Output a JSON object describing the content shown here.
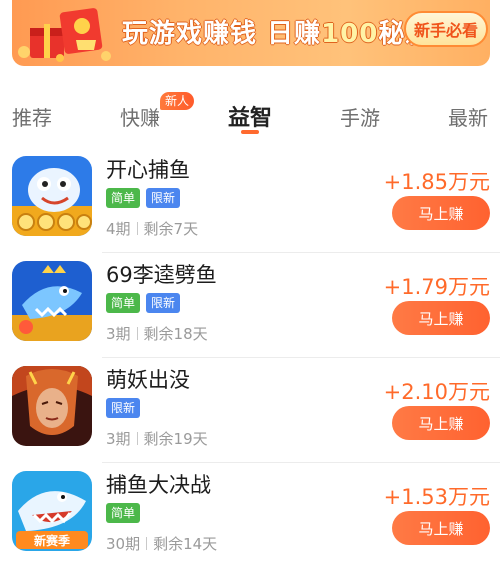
{
  "banner": {
    "title_prefix": "玩游戏赚钱 日赚",
    "title_amount": "100",
    "title_suffix": "秘籍",
    "button_label": "新手必看"
  },
  "tabs": {
    "items": [
      {
        "label": "推荐",
        "active": false
      },
      {
        "label": "快赚",
        "active": false,
        "badge": "新人"
      },
      {
        "label": "益智",
        "active": true
      },
      {
        "label": "手游",
        "active": false
      },
      {
        "label": "最新",
        "active": false
      }
    ]
  },
  "games": [
    {
      "name": "开心捕鱼",
      "tags": [
        "简单",
        "限新"
      ],
      "period": "4期",
      "remaining": "剩余7天",
      "reward": "+1.85万元",
      "button": "马上赚",
      "icon": "fish-game-icon"
    },
    {
      "name": "69李逵劈鱼",
      "tags": [
        "简单",
        "限新"
      ],
      "period": "3期",
      "remaining": "剩余18天",
      "reward": "+1.79万元",
      "button": "马上赚",
      "icon": "shark-game-icon"
    },
    {
      "name": "萌妖出没",
      "tags": [
        "限新"
      ],
      "period": "3期",
      "remaining": "剩余19天",
      "reward": "+2.10万元",
      "button": "马上赚",
      "icon": "demon-game-icon"
    },
    {
      "name": "捕鱼大决战",
      "tags": [
        "简单"
      ],
      "period": "30期",
      "remaining": "剩余14天",
      "reward": "+1.53万元",
      "button": "马上赚",
      "icon": "shark-season-game-icon"
    }
  ],
  "icon_overlay_text": "新赛季",
  "colors": {
    "accent": "#ff6a2f",
    "tag_simple": "#4cb84a",
    "tag_limited": "#4b86ef",
    "reward_text": "#ff6a2a"
  }
}
